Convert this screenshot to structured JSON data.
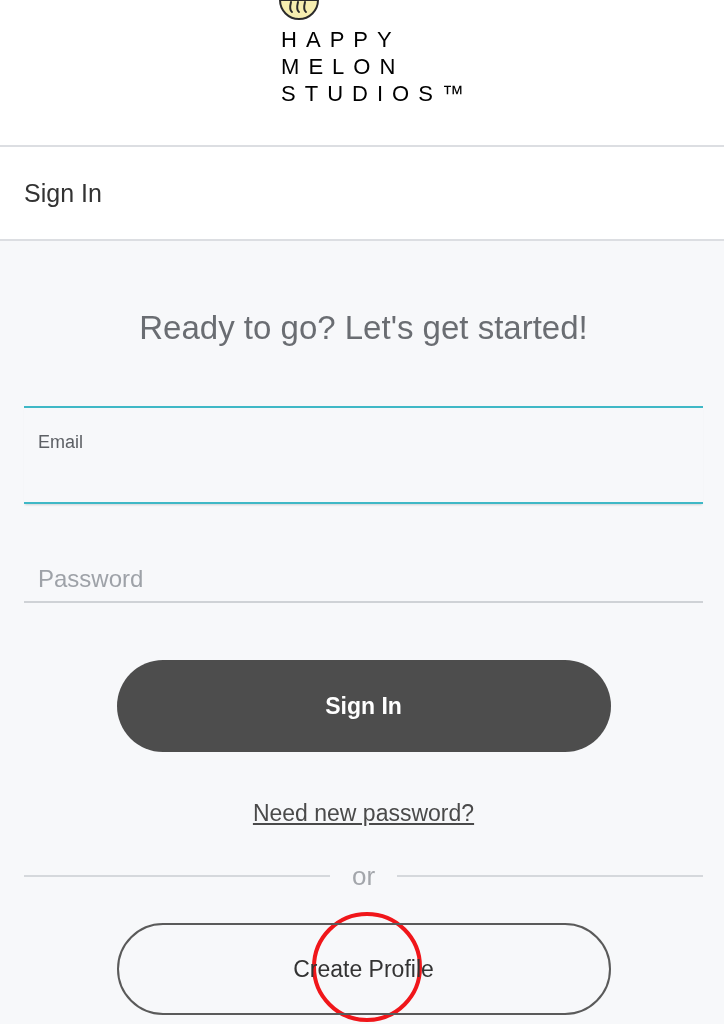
{
  "header": {
    "logo_lines": [
      "HAPPY",
      "MELON",
      "STUDIOS™"
    ]
  },
  "title_bar": {
    "title": "Sign In"
  },
  "form": {
    "heading": "Ready to go? Let's get started!",
    "fields": [
      {
        "label": "Email",
        "focused": true
      },
      {
        "placeholder": "Password",
        "focused": false
      }
    ],
    "sign_in_button": {
      "label": "Sign In"
    },
    "reset_link": {
      "label": "Need new password?"
    },
    "divider": {
      "label": "or"
    },
    "create_button": {
      "label": "Create Profile",
      "circled": true
    }
  }
}
